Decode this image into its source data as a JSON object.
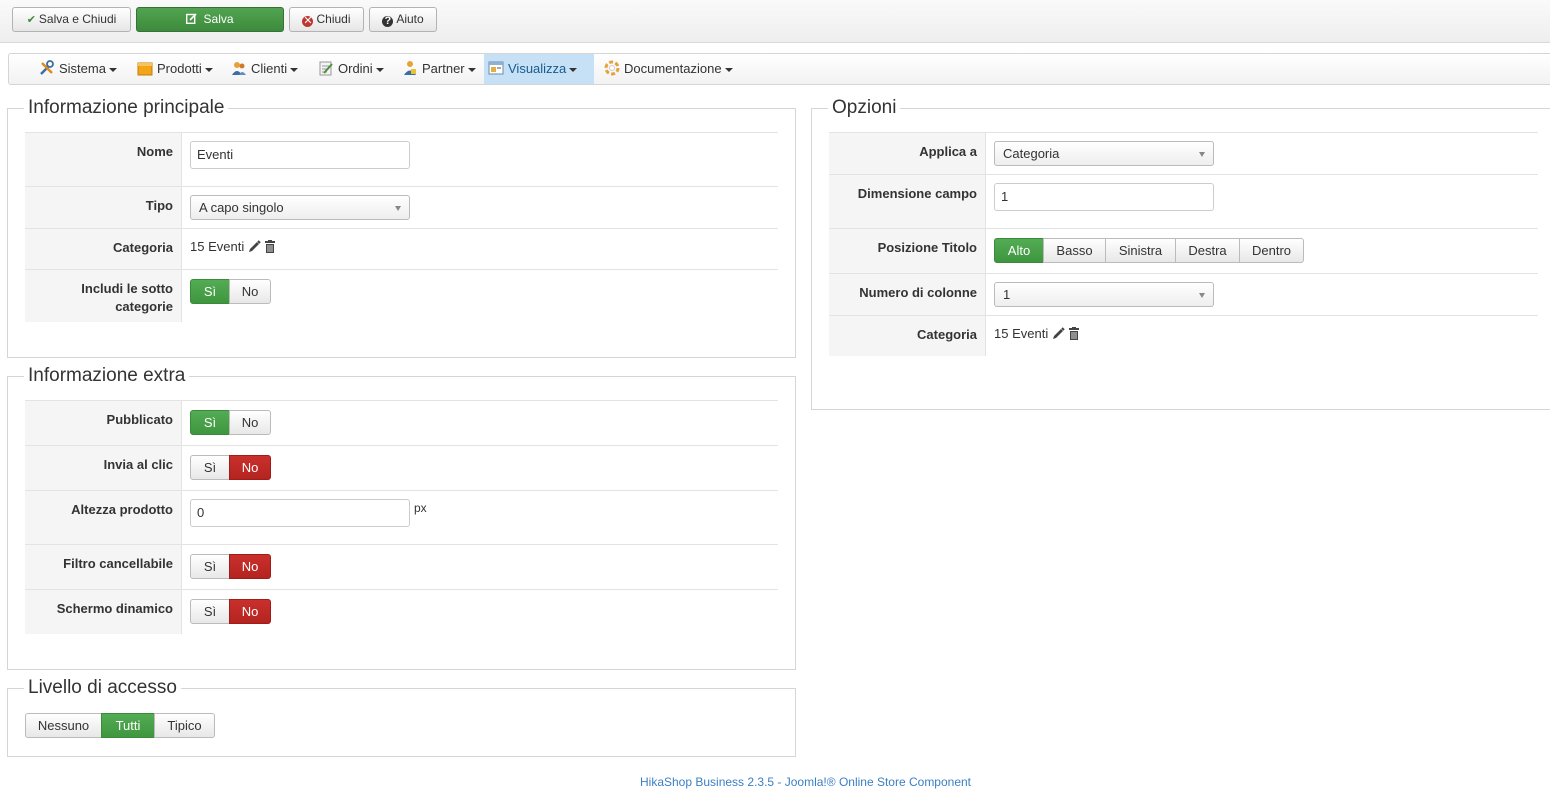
{
  "toolbar": {
    "save_close": "Salva e Chiudi",
    "save": "Salva",
    "close": "Chiudi",
    "help": "Aiuto"
  },
  "menu": {
    "items": [
      {
        "label": "Sistema",
        "icon": "tools-icon"
      },
      {
        "label": "Prodotti",
        "icon": "box-icon"
      },
      {
        "label": "Clienti",
        "icon": "users-icon"
      },
      {
        "label": "Ordini",
        "icon": "orders-icon"
      },
      {
        "label": "Partner",
        "icon": "partner-icon"
      },
      {
        "label": "Visualizza",
        "icon": "display-icon",
        "active": true
      },
      {
        "label": "Documentazione",
        "icon": "lifebuoy-icon"
      }
    ]
  },
  "main_info": {
    "legend": "Informazione principale",
    "name_label": "Nome",
    "name_value": "Eventi",
    "type_label": "Tipo",
    "type_value": "A capo singolo",
    "category_label": "Categoria",
    "category_value": "15 Eventi",
    "include_sub_label": "Includi le sotto categorie",
    "yes": "Sì",
    "no": "No",
    "include_sub_selected": "yes"
  },
  "extra_info": {
    "legend": "Informazione extra",
    "published_label": "Pubblicato",
    "published_selected": "yes",
    "send_click_label": "Invia al clic",
    "send_click_selected": "no",
    "height_label": "Altezza prodotto",
    "height_value": "0",
    "height_unit": "px",
    "filter_cancel_label": "Filtro cancellabile",
    "filter_cancel_selected": "no",
    "dynamic_screen_label": "Schermo dinamico",
    "dynamic_screen_selected": "no",
    "yes": "Sì",
    "no": "No"
  },
  "access": {
    "legend": "Livello di accesso",
    "options": [
      "Nessuno",
      "Tutti",
      "Tipico"
    ],
    "selected": "Tutti"
  },
  "options": {
    "legend": "Opzioni",
    "apply_label": "Applica a",
    "apply_value": "Categoria",
    "field_size_label": "Dimensione campo",
    "field_size_value": "1",
    "title_pos_label": "Posizione Titolo",
    "title_pos_options": [
      "Alto",
      "Basso",
      "Sinistra",
      "Destra",
      "Dentro"
    ],
    "title_pos_selected": "Alto",
    "columns_label": "Numero di colonne",
    "columns_value": "1",
    "category_label": "Categoria",
    "category_value": "15 Eventi"
  },
  "footer": {
    "text": "HikaShop Business 2.3.5 - Joomla!® Online Store Component"
  },
  "colors": {
    "green": "#4caa4c",
    "red": "#bd362f",
    "active_menu": "#c6e1f5"
  }
}
